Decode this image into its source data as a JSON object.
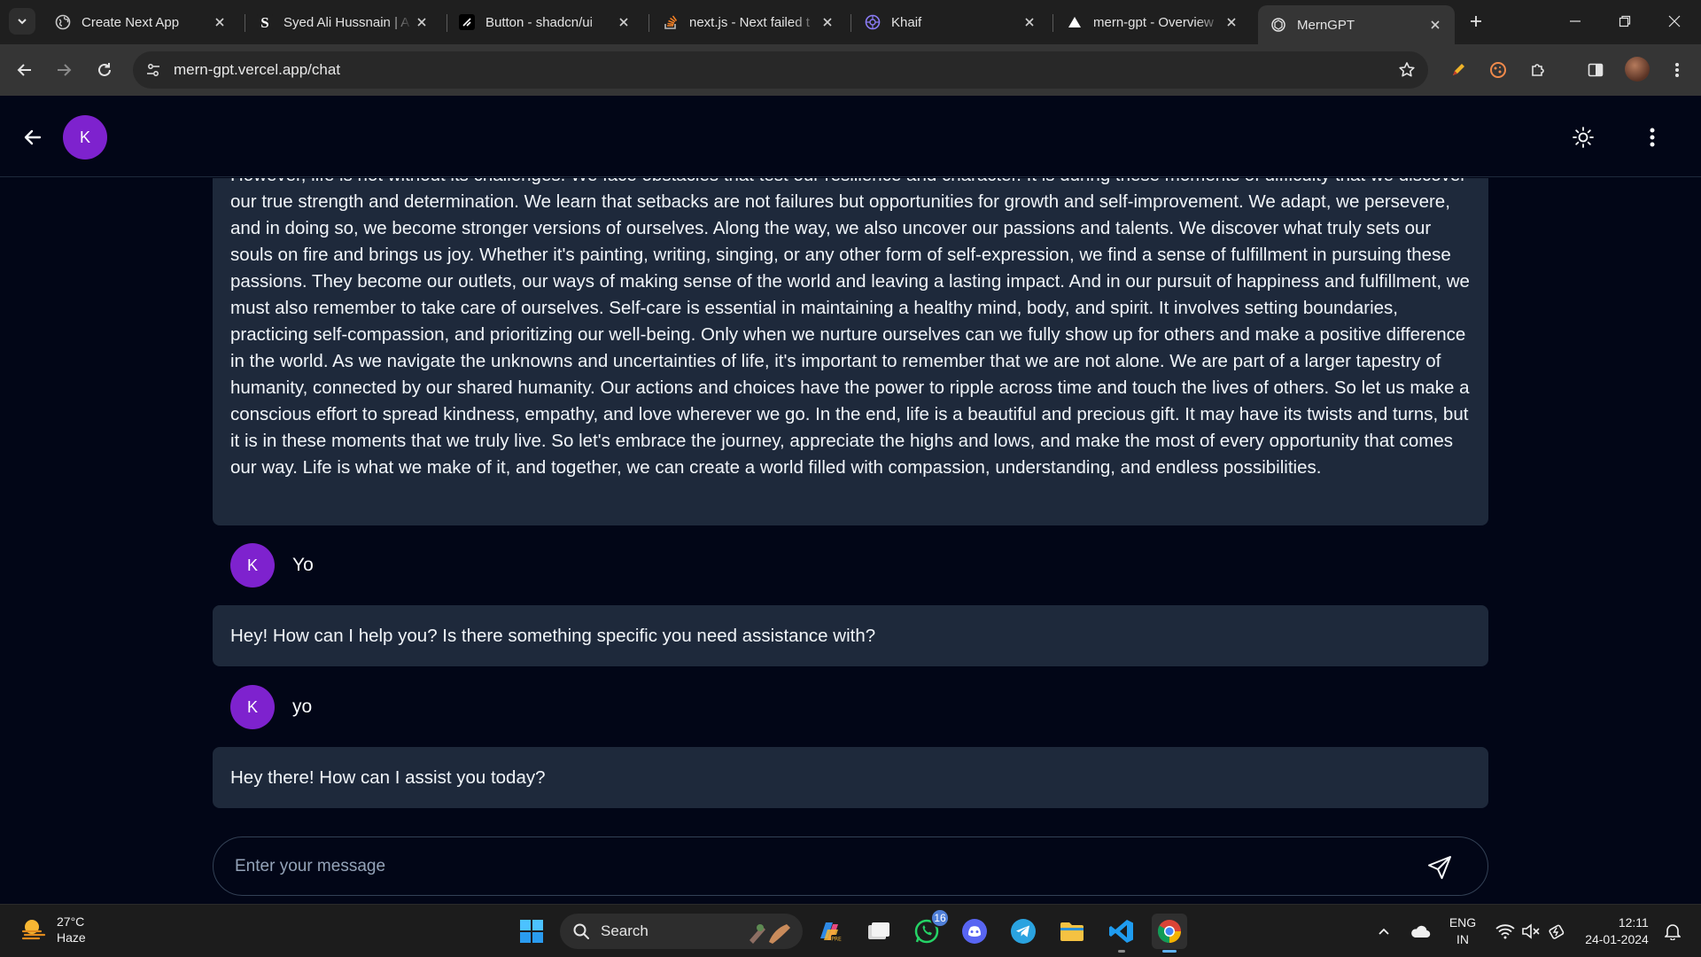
{
  "browser": {
    "tabs": [
      {
        "title": "Create Next App",
        "favicon": "globe-icon"
      },
      {
        "title": "Syed Ali Hussnain | A",
        "favicon": "s-logo-icon"
      },
      {
        "title": "Button - shadcn/ui",
        "favicon": "shadcn-icon"
      },
      {
        "title": "next.js - Next failed t",
        "favicon": "stackoverflow-icon"
      },
      {
        "title": "Khaif",
        "favicon": "khaif-icon"
      },
      {
        "title": "mern-gpt - Overview",
        "favicon": "vercel-icon"
      },
      {
        "title": "MernGPT",
        "favicon": "openai-icon",
        "active": true
      }
    ],
    "url": "mern-gpt.vercel.app/chat"
  },
  "app": {
    "header_avatar_initial": "K",
    "colors": {
      "accent": "#7e22ce",
      "bubble": "#1e293b",
      "background": "#020617"
    }
  },
  "chat": {
    "messages": [
      {
        "role": "assistant",
        "text": "However, life is not without its challenges. We face obstacles that test our resilience and character. It is during these moments of difficulty that we discover our true strength and determination. We learn that setbacks are not failures but opportunities for growth and self-improvement. We adapt, we persevere, and in doing so, we become stronger versions of ourselves. Along the way, we also uncover our passions and talents. We discover what truly sets our souls on fire and brings us joy. Whether it's painting, writing, singing, or any other form of self-expression, we find a sense of fulfillment in pursuing these passions. They become our outlets, our ways of making sense of the world and leaving a lasting impact. And in our pursuit of happiness and fulfillment, we must also remember to take care of ourselves. Self-care is essential in maintaining a healthy mind, body, and spirit. It involves setting boundaries, practicing self-compassion, and prioritizing our well-being. Only when we nurture ourselves can we fully show up for others and make a positive difference in the world. As we navigate the unknowns and uncertainties of life, it's important to remember that we are not alone. We are part of a larger tapestry of humanity, connected by our shared humanity. Our actions and choices have the power to ripple across time and touch the lives of others. So let us make a conscious effort to spread kindness, empathy, and love wherever we go. In the end, life is a beautiful and precious gift. It may have its twists and turns, but it is in these moments that we truly live. So let's embrace the journey, appreciate the highs and lows, and make the most of every opportunity that comes our way. Life is what we make of it, and together, we can create a world filled with compassion, understanding, and endless possibilities."
      },
      {
        "role": "user",
        "initial": "K",
        "text": "Yo"
      },
      {
        "role": "assistant",
        "text": "Hey! How can I help you? Is there something specific you need assistance with?"
      },
      {
        "role": "user",
        "initial": "K",
        "text": "yo"
      },
      {
        "role": "assistant",
        "text": "Hey there! How can I assist you today?"
      }
    ],
    "input": {
      "value": "",
      "placeholder": "Enter your message"
    }
  },
  "taskbar": {
    "weather_temp": "27°C",
    "weather_desc": "Haze",
    "search_label": "Search",
    "whatsapp_badge": "16",
    "lang_line1": "ENG",
    "lang_line2": "IN",
    "time": "12:11",
    "date": "24-01-2024"
  }
}
